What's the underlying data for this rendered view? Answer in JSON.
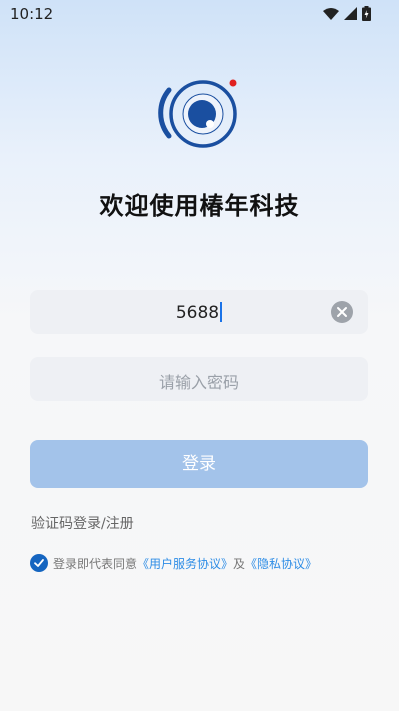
{
  "status_bar": {
    "time": "10:12",
    "icons": [
      "wifi-icon",
      "cell-signal-icon",
      "battery-icon"
    ]
  },
  "brand": {
    "logo_icon": "camera-lens-logo-icon",
    "welcome_text": "欢迎使用椿年科技",
    "accent_color": "#1a4fa0",
    "dot_color": "#e02020"
  },
  "form": {
    "phone_value": "5688",
    "password_placeholder": "请输入密码",
    "login_label": "登录",
    "sms_login_link": "验证码登录/注册"
  },
  "agreement": {
    "checked": true,
    "prefix": "登录即代表同意",
    "user_agreement": "《用户服务协议》",
    "and": "及",
    "privacy_policy": "《隐私协议》"
  }
}
